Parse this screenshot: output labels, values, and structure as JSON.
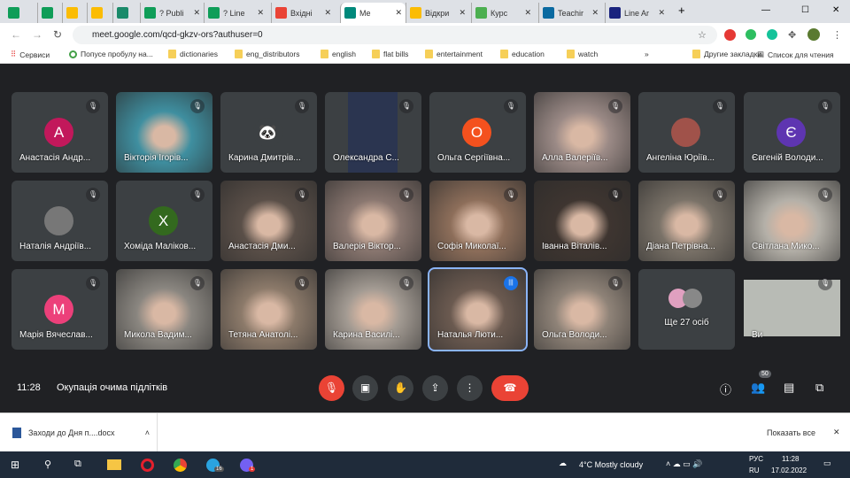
{
  "browser": {
    "tabs": [
      {
        "label": "",
        "color": "#0f9d58"
      },
      {
        "label": "",
        "color": "#0f9d58"
      },
      {
        "label": "",
        "color": "#fbbc04"
      },
      {
        "label": "",
        "color": "#fbbc04"
      },
      {
        "label": "",
        "color": "#1a8a6a"
      },
      {
        "label": "? Publi",
        "color": "#0f9d58"
      },
      {
        "label": "? Line",
        "color": "#0f9d58"
      },
      {
        "label": "Вхідні",
        "color": "#ea4335"
      },
      {
        "label": "Me",
        "color": "#00897b",
        "active": true
      },
      {
        "label": "Відкри",
        "color": "#fbbc04"
      },
      {
        "label": "Курс",
        "color": "#4caf50"
      },
      {
        "label": "Teachir",
        "color": "#0a6aa1"
      },
      {
        "label": "Line Ar",
        "color": "#1a237e"
      }
    ],
    "url": "meet.google.com/qcd-gkzv-ors?authuser=0",
    "bookmarks": [
      {
        "label": "Сервиси",
        "type": "apps"
      },
      {
        "label": "Попусе пробулу на...",
        "type": "site"
      },
      {
        "label": "dictionaries",
        "type": "folder"
      },
      {
        "label": "eng_distributors",
        "type": "folder"
      },
      {
        "label": "english",
        "type": "folder"
      },
      {
        "label": "flat bills",
        "type": "folder"
      },
      {
        "label": "entertainment",
        "type": "folder"
      },
      {
        "label": "education",
        "type": "folder"
      },
      {
        "label": "watch",
        "type": "folder"
      },
      {
        "label": "»",
        "type": "more"
      },
      {
        "label": "Другие закладки",
        "type": "folder"
      },
      {
        "label": "Список для чтения",
        "type": "list"
      }
    ]
  },
  "meet": {
    "participants": [
      {
        "name": "Анастасія Андр...",
        "avatar": "А",
        "color": "#c2185b"
      },
      {
        "name": "Вікторія Ігорів...",
        "video": "#3f8fa0"
      },
      {
        "name": "Карина Дмитрів...",
        "avatar": "🐼",
        "color": "#3c4043"
      },
      {
        "name": "Олександра С...",
        "video": "#2b3550"
      },
      {
        "name": "Ольга Сергіївна...",
        "avatar": "О",
        "color": "#f4511e"
      },
      {
        "name": "Алла Валеріїв...",
        "video": "#9b8a86"
      },
      {
        "name": "Ангеліна Юріїв...",
        "avatar": "",
        "color": "#a0524a"
      },
      {
        "name": "Євгеній Володи...",
        "avatar": "Є",
        "color": "#5e35b1"
      },
      {
        "name": "Наталія Андріїв...",
        "avatar": "",
        "color": "#777"
      },
      {
        "name": "Хоміда Маліков...",
        "avatar": "Х",
        "color": "#33691e"
      },
      {
        "name": "Анастасія Дми...",
        "video": "#5a4f48"
      },
      {
        "name": "Валерія Віктор...",
        "video": "#8a7770"
      },
      {
        "name": "Софія Миколаї...",
        "video": "#8d6e5a"
      },
      {
        "name": "Іванна Віталів...",
        "video": "#3e3530"
      },
      {
        "name": "Діана Петрівна...",
        "video": "#7a7268"
      },
      {
        "name": "Світлана Мико...",
        "video": "#b4b0a8"
      },
      {
        "name": "Марія Вячеслав...",
        "avatar": "М",
        "color": "#ec407a"
      },
      {
        "name": "Микола Вадим...",
        "video": "#8a8680"
      },
      {
        "name": "Тетяна Анатолі...",
        "video": "#8c7a6a"
      },
      {
        "name": "Карина Василі...",
        "video": "#a29a92"
      },
      {
        "name": "Наталья Люти...",
        "video": "#6b5a50",
        "speaking": true
      },
      {
        "name": "Ольга Володи...",
        "video": "#8f8378"
      },
      {
        "name": "Ще 27 осіб",
        "more": true
      },
      {
        "name": "Ви",
        "video": "#b8bbb5",
        "self": true
      }
    ],
    "time": "11:28",
    "meeting_title": "Окупація очима підлітків",
    "people_count": "50"
  },
  "download": {
    "file": "Заходи до Дня п....docx",
    "show_all": "Показать все"
  },
  "taskbar": {
    "weather": "4°C  Mostly cloudy",
    "lang": "РУС",
    "lang2": "RU",
    "time": "11:28",
    "date": "17.02.2022",
    "telegram_badge": "16",
    "viber_badge": "1"
  }
}
